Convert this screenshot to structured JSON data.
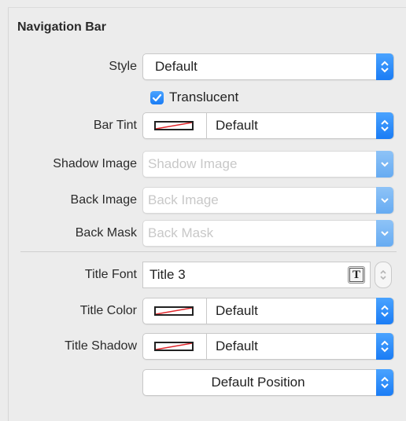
{
  "section": {
    "title": "Navigation Bar"
  },
  "style": {
    "label": "Style",
    "value": "Default"
  },
  "translucent": {
    "label": "Translucent",
    "checked": true
  },
  "bar_tint": {
    "label": "Bar Tint",
    "value": "Default"
  },
  "shadow_image": {
    "label": "Shadow Image",
    "placeholder": "Shadow Image"
  },
  "back_image": {
    "label": "Back Image",
    "placeholder": "Back Image"
  },
  "back_mask": {
    "label": "Back Mask",
    "placeholder": "Back Mask"
  },
  "title_font": {
    "label": "Title Font",
    "value": "Title 3",
    "font_button_glyph": "T"
  },
  "title_color": {
    "label": "Title Color",
    "value": "Default"
  },
  "title_shadow": {
    "label": "Title Shadow",
    "value": "Default"
  },
  "shadow_offset": {
    "value": "Default Position"
  },
  "colors": {
    "accent": "#1a7cf5",
    "background": "#ececec",
    "swatch_slash": "#e0262b"
  }
}
